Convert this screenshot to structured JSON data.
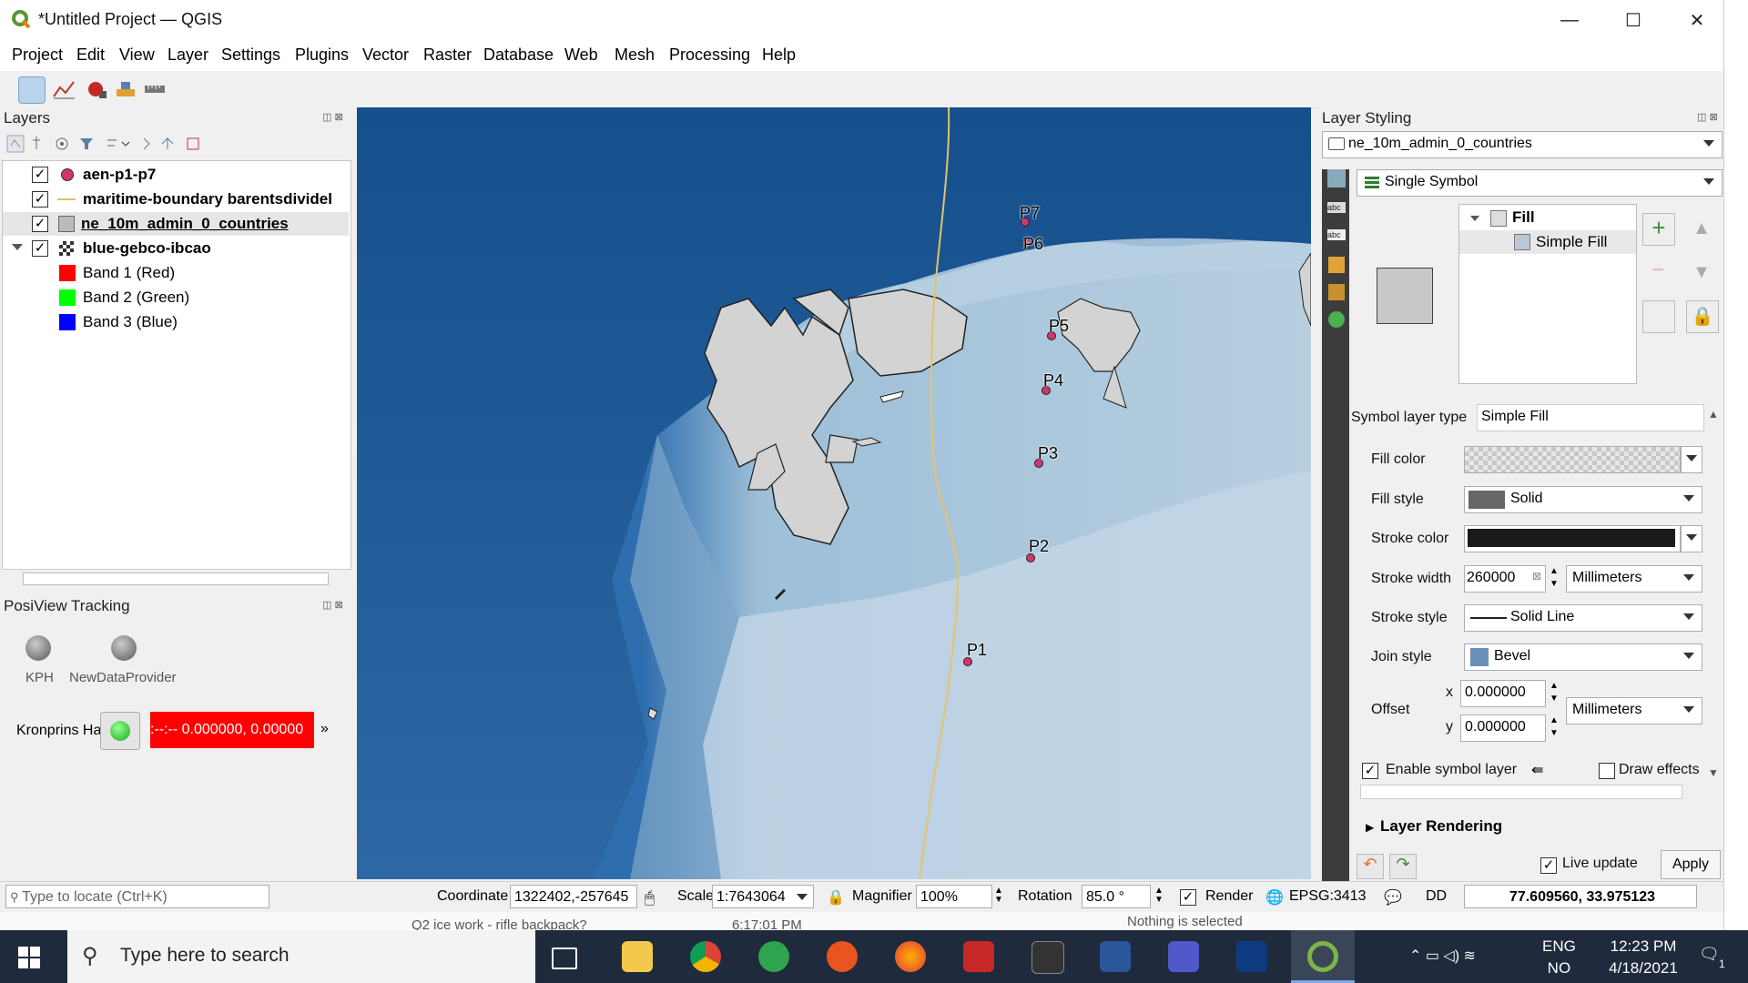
{
  "window": {
    "title": "*Untitled Project — QGIS",
    "minimize": "—",
    "maximize": "☐",
    "close": "✕"
  },
  "menu": [
    "Project",
    "Edit",
    "View",
    "Layer",
    "Settings",
    "Plugins",
    "Vector",
    "Raster",
    "Database",
    "Web",
    "Mesh",
    "Processing",
    "Help"
  ],
  "layers_panel": {
    "title": "Layers",
    "layers": [
      {
        "name": "aen-p1-p7",
        "checked": true
      },
      {
        "name": "maritime-boundary barentsdividel",
        "checked": true
      },
      {
        "name": "ne_10m_admin_0_countries",
        "checked": true
      },
      {
        "name": "blue-gebco-ibcao",
        "checked": true
      }
    ],
    "bands": [
      {
        "name": "Band 1 (Red)",
        "color": "#ff0000"
      },
      {
        "name": "Band 2 (Green)",
        "color": "#00ff00"
      },
      {
        "name": "Band 3 (Blue)",
        "color": "#0000ff"
      }
    ]
  },
  "posiview": {
    "title": "PosiView Tracking",
    "providers": [
      "KPH",
      "NewDataProvider"
    ],
    "vessel_label": "Kronprins Ha",
    "position_readout": ":--:-- 0.000000, 0.00000",
    "more": "»"
  },
  "map": {
    "points": [
      "P7",
      "P6",
      "P5",
      "P4",
      "P3",
      "P2",
      "P1"
    ]
  },
  "styling": {
    "title": "Layer Styling",
    "layer": "ne_10m_admin_0_countries",
    "renderer": "Single Symbol",
    "tree_fill": "Fill",
    "tree_simple_fill": "Simple Fill",
    "symbol_layer_type_label": "Symbol layer type",
    "symbol_layer_type": "Simple Fill",
    "fill_color_label": "Fill color",
    "fill_style_label": "Fill style",
    "fill_style": "Solid",
    "stroke_color_label": "Stroke color",
    "stroke_width_label": "Stroke width",
    "stroke_width": "260000",
    "stroke_width_unit": "Millimeters",
    "stroke_style_label": "Stroke style",
    "stroke_style": "Solid Line",
    "join_style_label": "Join style",
    "join_style": "Bevel",
    "offset_label": "Offset",
    "offset_x_label": "x",
    "offset_x": "0.000000",
    "offset_y_label": "y",
    "offset_y": "0.000000",
    "offset_unit": "Millimeters",
    "enable_symbol_layer": "Enable symbol layer",
    "draw_effects": "Draw effects",
    "layer_rendering": "Layer Rendering",
    "live_update": "Live update",
    "apply": "Apply"
  },
  "statusbar": {
    "locate_placeholder": "Type to locate (Ctrl+K)",
    "coordinate_label": "Coordinate",
    "coordinate": "1322402,-257645",
    "scale_label": "Scale",
    "scale": "1:7643064",
    "magnifier_label": "Magnifier",
    "magnifier": "100%",
    "rotation_label": "Rotation",
    "rotation": "85.0 °",
    "render_label": "Render",
    "crs": "EPSG:3413",
    "dd": "DD",
    "dd_value": "77.609560, 33.975123"
  },
  "background_app": {
    "item": "Q2 ice work - rifle backpack?",
    "time": "6:17:01 PM",
    "status": "Nothing is selected"
  },
  "taskbar": {
    "search_placeholder": "Type here to search",
    "lang1": "ENG",
    "lang2": "NO",
    "time": "12:23 PM",
    "date": "4/18/2021",
    "notif_count": "1"
  },
  "colors": {
    "accent_red": "#ff0000",
    "map_deep": "#1d5aa0",
    "map_shallow": "#bdd3e4",
    "land": "#d0d0d0"
  }
}
